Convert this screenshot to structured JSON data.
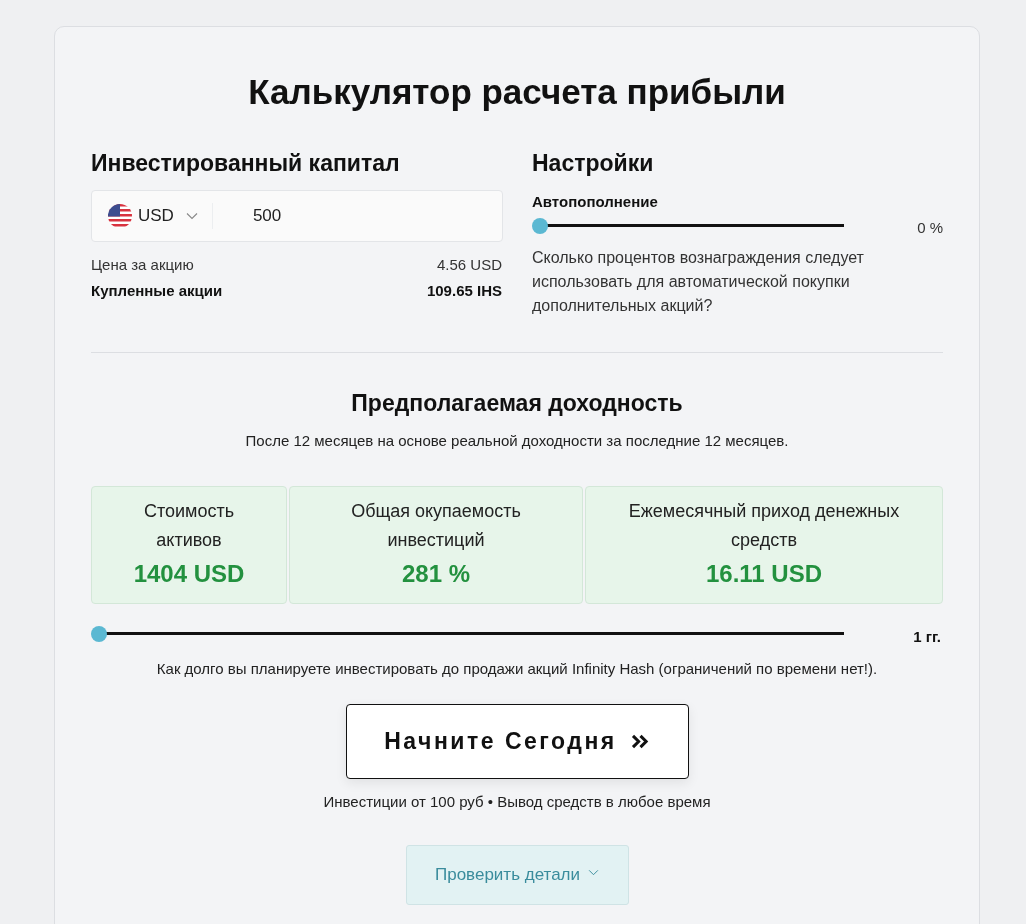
{
  "title": "Калькулятор расчета прибыли",
  "capital": {
    "heading": "Инвестированный капитал",
    "currency": "USD",
    "amount": "500",
    "rows": [
      {
        "label": "Цена за акцию",
        "value": "4.56 USD",
        "kind": "normal"
      },
      {
        "label": "Купленные акции",
        "value": "109.65 IHS",
        "kind": "bold"
      }
    ]
  },
  "settings": {
    "heading": "Настройки",
    "autofill": {
      "label": "Автопополнение",
      "level": 0,
      "reading": "0 %"
    },
    "description": "Сколько процентов вознаграждения следует использовать для автоматической покупки дополнительных акций?"
  },
  "returns": {
    "heading": "Предполагаемая доходность",
    "subtitle": "После 12 месяцев на основе реальной доходности за последние 12 месяцев.",
    "metrics": [
      {
        "label": "Стоимость активов",
        "value": "1404 USD"
      },
      {
        "label": "Общая окупаемость инвестиций",
        "value": "281 %"
      },
      {
        "label": "Ежемесячный приход денежных средств",
        "value": "16.11 USD"
      }
    ],
    "period": {
      "level": 0,
      "reading": "1 гг.",
      "caption": "Как долго вы планируете инвестировать до продажи акций Infinity Hash (ограничений по времени нет!)."
    }
  },
  "cta": {
    "label": "Начните Сегодня",
    "note": "Инвестиции от 100 руб • Вывод средств в любое время"
  },
  "details_button": {
    "label": "Проверить детали"
  }
}
